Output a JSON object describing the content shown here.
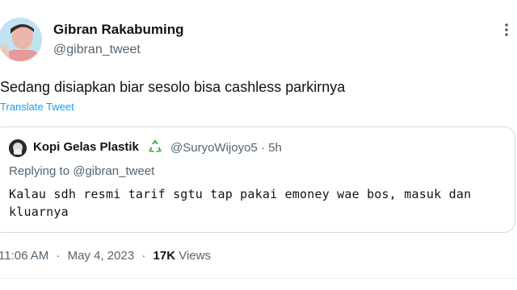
{
  "tweet": {
    "author_name": "Gibran Rakabuming",
    "author_handle": "@gibran_tweet",
    "text": "Sedang disiapkan biar sesolo bisa cashless parkirnya",
    "translate_label": "Translate Tweet",
    "time": "11:06 AM",
    "date": "May 4, 2023",
    "views_count": "17K",
    "views_label": "Views",
    "separator": "·"
  },
  "quote": {
    "author_name": "Kopi Gelas Plastik",
    "emoji_icon": "recycle-icon",
    "author_handle": "@SuryoWijoyo5",
    "separator": "·",
    "time_ago": "5h",
    "replying_label": "Replying to",
    "replying_handle": "@gibran_tweet",
    "text": "Kalau sdh resmi tarif sgtu tap pakai emoney wae bos, masuk dan kluarnya"
  },
  "colors": {
    "link": "#1d9bf0",
    "secondary_text": "#536471",
    "border": "#cfd9de",
    "recycle_green": "#3fae49"
  }
}
